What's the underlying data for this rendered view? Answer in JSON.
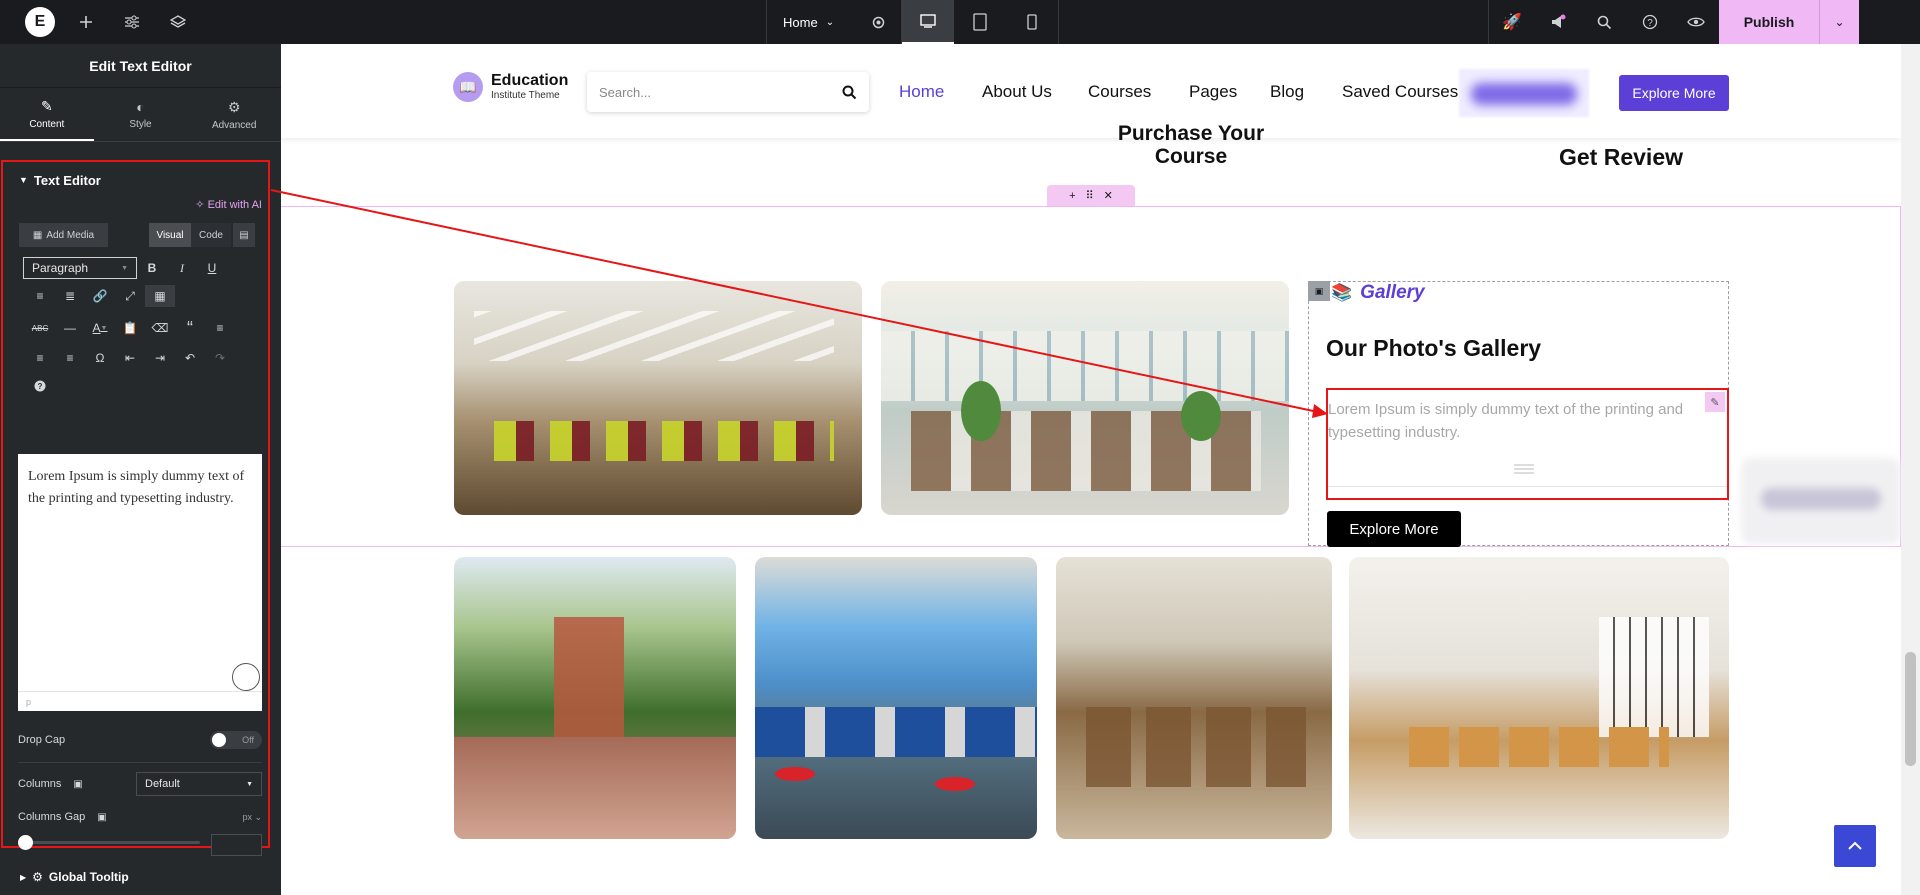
{
  "topbar": {
    "page_select": "Home",
    "publish_label": "Publish"
  },
  "sidebar": {
    "title": "Edit Text Editor",
    "tabs": [
      {
        "label": "Content"
      },
      {
        "label": "Style"
      },
      {
        "label": "Advanced"
      }
    ],
    "section_title": "Text Editor",
    "edit_ai_label": "Edit with AI",
    "add_media_label": "Add Media",
    "visual_label": "Visual",
    "code_label": "Code",
    "format_select": "Paragraph",
    "editor_text": "Lorem Ipsum is simply dummy text of the printing and typesetting industry.",
    "editor_path": "p",
    "drop_cap_label": "Drop Cap",
    "drop_cap_toggle": "Off",
    "columns_label": "Columns",
    "columns_value": "Default",
    "columns_gap_label": "Columns Gap",
    "columns_gap_unit": "px",
    "global_tooltip_label": "Global Tooltip"
  },
  "site": {
    "logo_title": "Education",
    "logo_subtitle": "Institute Theme",
    "search_placeholder": "Search...",
    "nav": [
      "Home",
      "About Us",
      "Courses",
      "Pages",
      "Blog",
      "Saved Courses"
    ],
    "header_button": "Explore More",
    "step_left_line1": "Purchase Your",
    "step_left_line2": "Course",
    "step_right": "Get Review",
    "gallery_tag": "Gallery",
    "gallery_title": "Our Photo's Gallery",
    "gallery_text": "Lorem Ipsum is simply dummy text of the printing and typesetting industry.",
    "gallery_button": "Explore More"
  },
  "colors": {
    "accent": "#5b3fd6",
    "publish_bg": "#f0b8f5",
    "annotation": "#e61616"
  }
}
